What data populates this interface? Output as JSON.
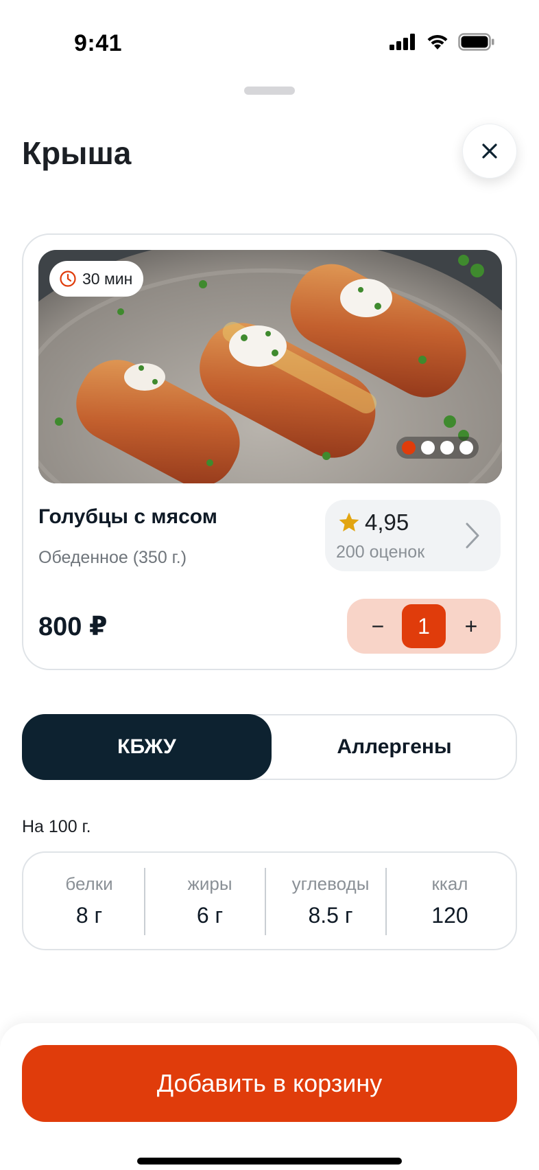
{
  "status_bar": {
    "time": "9:41"
  },
  "header": {
    "title": "Крыша"
  },
  "product": {
    "time_badge": "30 мин",
    "photo_count": 4,
    "active_photo": 1,
    "name": "Голубцы с мясом",
    "subtitle": "Обеденное (350 г.)",
    "rating_value": "4,95",
    "rating_count": "200 оценок",
    "price": "800 ₽",
    "quantity": "1",
    "minus": "−",
    "plus": "+"
  },
  "tabs": [
    {
      "label": "КБЖУ",
      "active": true
    },
    {
      "label": "Аллергены",
      "active": false
    }
  ],
  "nutrition": {
    "caption": "На 100 г.",
    "items": [
      {
        "label": "белки",
        "value": "8 г"
      },
      {
        "label": "жиры",
        "value": "6 г"
      },
      {
        "label": "углеводы",
        "value": "8.5 г"
      },
      {
        "label": "ккал",
        "value": "120"
      }
    ]
  },
  "cta": {
    "label": "Добавить в корзину"
  },
  "colors": {
    "accent": "#e03c0b",
    "dark": "#0d2230",
    "stepper_bg": "#f8d4c8",
    "star": "#e2a511"
  }
}
